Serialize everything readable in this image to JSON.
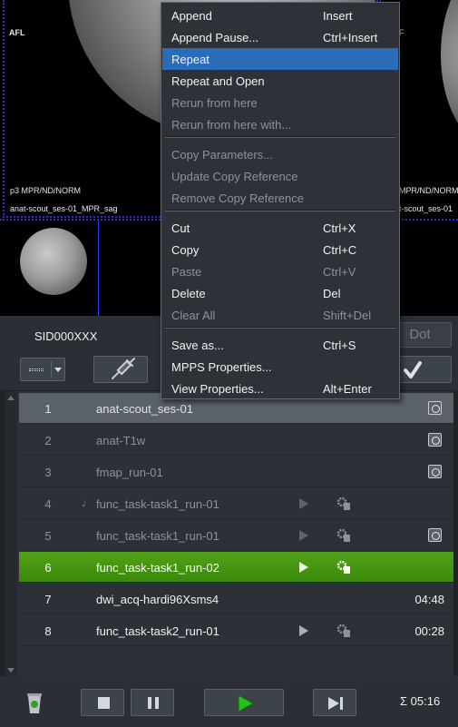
{
  "viewer": {
    "orientation_label": "AFL",
    "right_orientation": "F",
    "main_info": "p3 MPR/ND/NORM",
    "main_series": "anat-scout_ses-01_MPR_sag",
    "right_info": "MPR/ND/NORM",
    "right_series": "t-scout_ses-01"
  },
  "controls": {
    "patient_id": "SID000XXX",
    "dot_label": "Dot"
  },
  "context_menu": {
    "items": [
      {
        "label": "Append",
        "shortcut": "Insert",
        "disabled": false
      },
      {
        "label": "Append Pause...",
        "shortcut": "Ctrl+Insert",
        "disabled": false
      },
      {
        "label": "Repeat",
        "shortcut": "",
        "disabled": false,
        "highlighted": true
      },
      {
        "label": "Repeat and Open",
        "shortcut": "",
        "disabled": false
      },
      {
        "label": "Rerun from here",
        "shortcut": "",
        "disabled": true
      },
      {
        "label": "Rerun from here with...",
        "shortcut": "",
        "disabled": true
      },
      {
        "label": "Copy Parameters...",
        "shortcut": "",
        "disabled": true
      },
      {
        "label": "Update Copy Reference",
        "shortcut": "",
        "disabled": true
      },
      {
        "label": "Remove Copy Reference",
        "shortcut": "",
        "disabled": true
      },
      {
        "label": "Cut",
        "shortcut": "Ctrl+X",
        "disabled": false
      },
      {
        "label": "Copy",
        "shortcut": "Ctrl+C",
        "disabled": false
      },
      {
        "label": "Paste",
        "shortcut": "Ctrl+V",
        "disabled": true
      },
      {
        "label": "Delete",
        "shortcut": "Del",
        "disabled": false
      },
      {
        "label": "Clear All",
        "shortcut": "Shift+Del",
        "disabled": true
      },
      {
        "label": "Save as...",
        "shortcut": "Ctrl+S",
        "disabled": false
      },
      {
        "label": "MPPS Properties...",
        "shortcut": "",
        "disabled": false
      },
      {
        "label": "View Properties...",
        "shortcut": "Alt+Enter",
        "disabled": false
      }
    ]
  },
  "protocol_list": {
    "rows": [
      {
        "num": "1",
        "name": "anat-scout_ses-01",
        "state": "done",
        "time": "",
        "play": false,
        "gear": false,
        "doc": true,
        "dot": ""
      },
      {
        "num": "2",
        "name": "anat-T1w",
        "state": "inactive",
        "time": "",
        "play": false,
        "gear": false,
        "doc": true,
        "dot": ""
      },
      {
        "num": "3",
        "name": "fmap_run-01",
        "state": "inactive",
        "time": "",
        "play": false,
        "gear": false,
        "doc": true,
        "dot": ""
      },
      {
        "num": "4",
        "name": "func_task-task1_run-01",
        "state": "inactive",
        "time": "",
        "play": true,
        "gear": true,
        "doc": false,
        "dot": "♩"
      },
      {
        "num": "5",
        "name": "func_task-task1_run-01",
        "state": "inactive",
        "time": "",
        "play": true,
        "gear": true,
        "doc": true,
        "dot": ""
      },
      {
        "num": "6",
        "name": "func_task-task1_run-02",
        "state": "active",
        "time": "",
        "play": true,
        "gear": true,
        "doc": false,
        "dot": ""
      },
      {
        "num": "7",
        "name": "dwi_acq-hardi96Xsms4",
        "state": "pending",
        "time": "04:48",
        "play": false,
        "gear": false,
        "doc": false,
        "dot": ""
      },
      {
        "num": "8",
        "name": "func_task-task2_run-01",
        "state": "pending",
        "time": "00:28",
        "play": true,
        "gear": true,
        "doc": false,
        "dot": ""
      }
    ]
  },
  "bottom": {
    "total_time": "Σ 05:16"
  },
  "colors": {
    "active_row": "#44961a",
    "menu_highlight": "#2b6cb8",
    "play_button_icon": "#22c11e"
  }
}
